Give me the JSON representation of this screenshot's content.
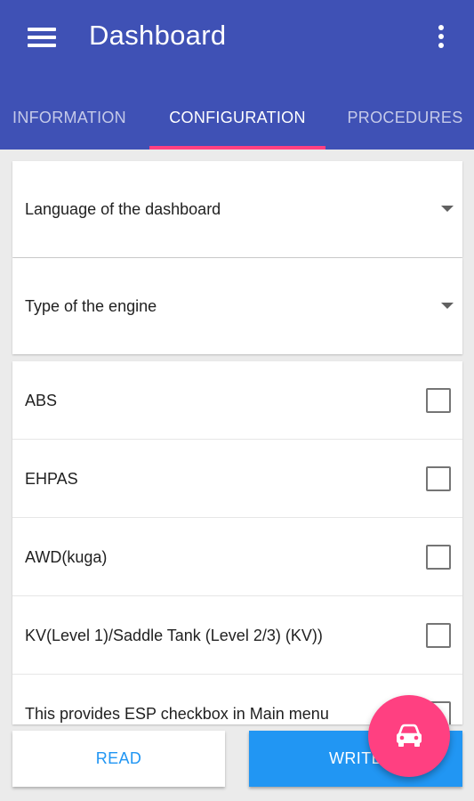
{
  "app_bar": {
    "title": "Dashboard",
    "menu_icon": "hamburger-menu-icon",
    "overflow_icon": "more-vert-icon",
    "color": "#3f51b5"
  },
  "tabs": [
    {
      "label": "INFORMATION",
      "selected": false
    },
    {
      "label": "CONFIGURATION",
      "selected": true
    },
    {
      "label": "PROCEDURES",
      "selected": false
    }
  ],
  "tab_indicator_color": "#ff4081",
  "selects": [
    {
      "label": "Language of the dashboard",
      "icon": "dropdown-arrow-icon"
    },
    {
      "label": "Type of the engine",
      "icon": "dropdown-arrow-icon"
    }
  ],
  "options": [
    {
      "label": "ABS",
      "checked": false
    },
    {
      "label": "EHPAS",
      "checked": false
    },
    {
      "label": "AWD(kuga)",
      "checked": false
    },
    {
      "label": "KV(Level 1)/Saddle Tank (Level 2/3) (KV))",
      "checked": false
    },
    {
      "label": "This provides ESP checkbox in Main menu",
      "checked": false
    }
  ],
  "buttons": {
    "read_label": "READ",
    "write_label": "WRITE"
  },
  "fab": {
    "icon": "car-icon",
    "color": "#ff4081"
  },
  "accent_color": "#2196f3"
}
